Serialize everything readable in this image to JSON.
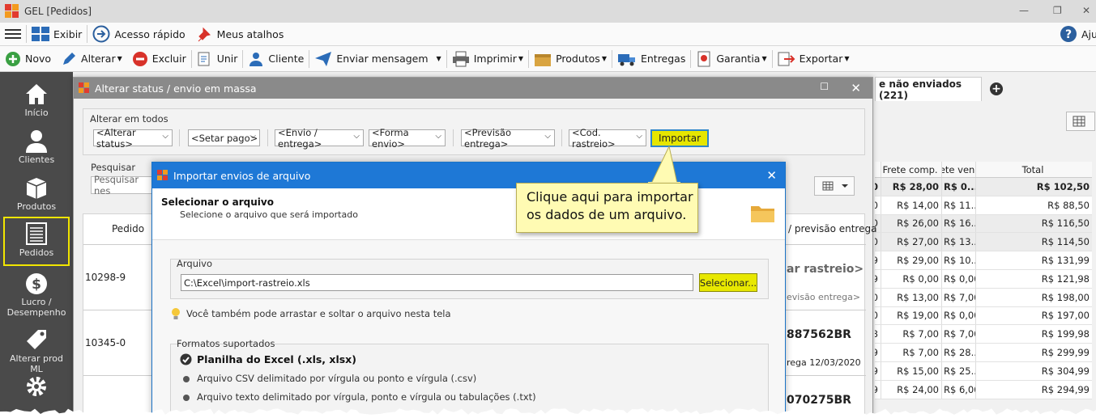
{
  "app": {
    "title": "GEL [Pedidos]",
    "help_label": "Aju",
    "colors": {
      "accent": "#1e78d6",
      "highlight": "#f2e600",
      "sidebar": "#4a4a4a"
    }
  },
  "toolbar1": {
    "exibir": "Exibir",
    "acesso_rapido": "Acesso rápido",
    "meus_atalhos": "Meus atalhos"
  },
  "toolbar2": {
    "novo": "Novo",
    "alterar": "Alterar",
    "excluir": "Excluir",
    "unir": "Unir",
    "cliente": "Cliente",
    "enviar_mensagem": "Enviar mensagem",
    "imprimir": "Imprimir",
    "produtos": "Produtos",
    "entregas": "Entregas",
    "garantia": "Garantia",
    "exportar": "Exportar"
  },
  "sidebar": {
    "items": [
      {
        "label": "Início",
        "icon": "home-icon"
      },
      {
        "label": "Clientes",
        "icon": "user-icon"
      },
      {
        "label": "Produtos",
        "icon": "box-icon"
      },
      {
        "label": "Pedidos",
        "icon": "list-icon"
      },
      {
        "label": "Lucro / Desempenho",
        "icon": "dollar-icon"
      },
      {
        "label": "Alterar prod ML",
        "icon": "tag-icon"
      },
      {
        "label": "",
        "icon": "gear-icon"
      }
    ]
  },
  "background": {
    "tab_label": "e não enviados (221)",
    "table": {
      "headers": [
        "Frete comp.",
        "rete vend",
        "Total"
      ],
      "first_col_char": "0",
      "rows": [
        {
          "c0": "0",
          "frete_comp": "R$ 28,00",
          "frete_vend": "R$ 0...",
          "total": "R$ 102,50",
          "bold": true
        },
        {
          "c0": "0",
          "frete_comp": "R$ 14,00",
          "frete_vend": "R$ 11...",
          "total": "R$ 88,50"
        },
        {
          "c0": "0",
          "frete_comp": "R$ 26,00",
          "frete_vend": "R$ 16...",
          "total": "R$ 116,50"
        },
        {
          "c0": "0",
          "frete_comp": "R$ 27,00",
          "frete_vend": "R$ 13...",
          "total": "R$ 114,50"
        },
        {
          "c0": "9",
          "frete_comp": "R$ 29,00",
          "frete_vend": "R$ 10...",
          "total": "R$ 131,99"
        },
        {
          "c0": "9",
          "frete_comp": "R$ 0,00",
          "frete_vend": "R$ 0,00",
          "total": "R$ 121,98"
        },
        {
          "c0": "0",
          "frete_comp": "R$ 13,00",
          "frete_vend": "R$ 7,00",
          "total": "R$ 198,00"
        },
        {
          "c0": "0",
          "frete_comp": "R$ 19,00",
          "frete_vend": "R$ 0,00",
          "total": "R$ 197,00"
        },
        {
          "c0": "8",
          "frete_comp": "R$ 7,00",
          "frete_vend": "R$ 7,00",
          "total": "R$ 199,98"
        },
        {
          "c0": "9",
          "frete_comp": "R$ 7,00",
          "frete_vend": "R$ 28...",
          "total": "R$ 299,99"
        },
        {
          "c0": "9",
          "frete_comp": "R$ 15,00",
          "frete_vend": "R$ 25...",
          "total": "R$ 304,99"
        },
        {
          "c0": "9",
          "frete_comp": "R$ 24,00",
          "frete_vend": "R$ 6,00",
          "total": "R$ 294,99"
        }
      ]
    }
  },
  "mass_dialog": {
    "title": "Alterar status / envio em massa",
    "group_label": "Alterar em todos",
    "combos": {
      "status": "<Alterar status>",
      "pago": "<Setar pago>",
      "envio": "<Envio / entrega>",
      "forma": "<Forma envio>",
      "previsao": "<Previsão entrega>",
      "rastreio": "<Cod. rastreio>"
    },
    "import_button": "Importar",
    "search_label": "Pesquisar",
    "search_placeholder": "Pesquisar nes",
    "table": {
      "pedido_header": "Pedido",
      "previsao_header": "/ previsão entrega",
      "rows": [
        {
          "pedido": "10298-9",
          "right_bold": "ar rastreio>",
          "right_sub": "evisão entrega>"
        },
        {
          "pedido": "10345-0",
          "right_bold": "887562BR",
          "right_sub": "rega 12/03/2020"
        },
        {
          "pedido": "",
          "right_bold": "070275BR",
          "right_sub": ""
        }
      ]
    }
  },
  "import_dialog": {
    "title": "Importar envios de arquivo",
    "heading": "Selecionar o arquivo",
    "subheading": "Selecione o arquivo que será importado",
    "arquivo_label": "Arquivo",
    "arquivo_value": "C:\\Excel\\import-rastreio.xls",
    "select_button": "Selecionar...",
    "drag_tip": "Você também pode arrastar e soltar o arquivo nesta tela",
    "formats_label": "Formatos suportados",
    "formats": [
      "Planilha do Excel (.xls, xlsx)",
      "Arquivo CSV delimitado por vírgula ou ponto e vírgula (.csv)",
      "Arquivo texto delimitado por vírgula, ponto e vírgula ou tabulações (.txt)"
    ]
  },
  "callout": {
    "line1": "Clique aqui para importar",
    "line2": "os dados de um arquivo."
  }
}
